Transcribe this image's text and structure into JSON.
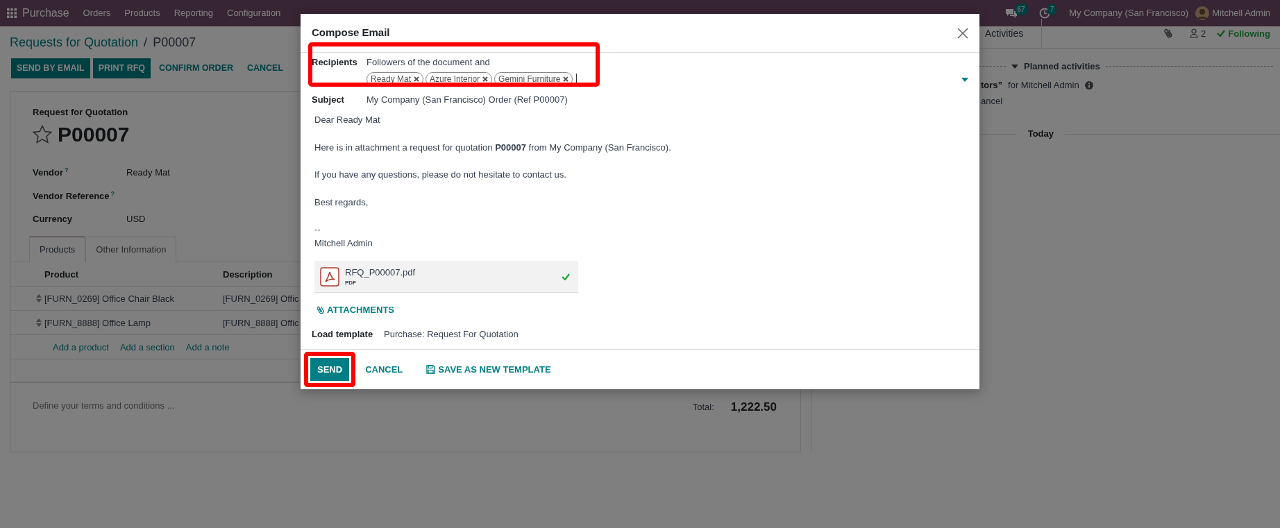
{
  "navbar": {
    "app": "Purchase",
    "menus": [
      "Orders",
      "Products",
      "Reporting",
      "Configuration"
    ],
    "messages_count": "67",
    "activities_count": "7",
    "company": "My Company (San Francisco)",
    "user": "Mitchell Admin"
  },
  "breadcrumb": {
    "parent": "Requests for Quotation",
    "separator": "/",
    "current": "P00007"
  },
  "actions": [
    {
      "label": "SEND BY EMAIL",
      "kind": "primary"
    },
    {
      "label": "PRINT RFQ",
      "kind": "primary"
    },
    {
      "label": "CONFIRM ORDER",
      "kind": "secondary"
    },
    {
      "label": "CANCEL",
      "kind": "secondary"
    }
  ],
  "form": {
    "subtitle": "Request for Quotation",
    "name": "P00007",
    "starred": false,
    "fields": [
      {
        "label": "Vendor",
        "help": "?",
        "value": "Ready Mat"
      },
      {
        "label": "Vendor Reference",
        "help": "?"
      },
      {
        "label": "Currency",
        "value": "USD"
      }
    ],
    "tabs": [
      {
        "label": "Products",
        "selected": true
      },
      {
        "label": "Other Information",
        "selected": false
      }
    ],
    "table": {
      "columns": [
        "Product",
        "Description"
      ],
      "rows": [
        [
          "[FURN_0269] Office Chair Black",
          "[FURN_0269] Offic"
        ],
        [
          "[FURN_8888] Office Lamp",
          "[FURN_8888] Offic"
        ]
      ]
    },
    "add_links": [
      "Add a product",
      "Add a section",
      "Add a note"
    ],
    "terms": {
      "placeholder": "Define your terms and conditions ..."
    },
    "total": {
      "label": "Total:",
      "value": "1,222.50"
    }
  },
  "chatter": {
    "tab": "Activities",
    "followers": "2",
    "follow_label": "Following",
    "following": true,
    "section": "Planned activities",
    "activity": {
      "title_tail": "tors”",
      "text": "for Mitchell Admin",
      "action": "ancel"
    },
    "date_label": "Today"
  },
  "dialog": {
    "title": "Compose Email",
    "recipients": {
      "label": "Recipients",
      "note": "Followers of the document and",
      "tags": [
        "Ready Mat",
        "Azure Interior",
        "Gemini Furniture"
      ],
      "highlighted": true
    },
    "subject": {
      "label": "Subject",
      "value": "My Company (San Francisco) Order (Ref P00007)"
    },
    "body": [
      "Dear Ready Mat",
      "Here is in attachment a request for quotation **P00007** from My Company (San Francisco).",
      "If you have any questions, please do not hesitate to contact us.",
      "Best regards,"
    ],
    "signature": [
      "--",
      "Mitchell Admin"
    ],
    "attachment": {
      "name": "RFQ_P00007.pdf",
      "type": "PDF",
      "uploaded": true
    },
    "attachments_button": "ATTACHMENTS",
    "template": {
      "label": "Load template",
      "value": "Purchase: Request For Quotation"
    },
    "buttons": [
      {
        "label": "SEND",
        "kind": "primary",
        "highlighted": true
      },
      {
        "label": "CANCEL",
        "kind": "link",
        "highlighted": false
      },
      {
        "label": "SAVE AS NEW TEMPLATE",
        "kind": "save",
        "highlighted": false
      }
    ]
  }
}
